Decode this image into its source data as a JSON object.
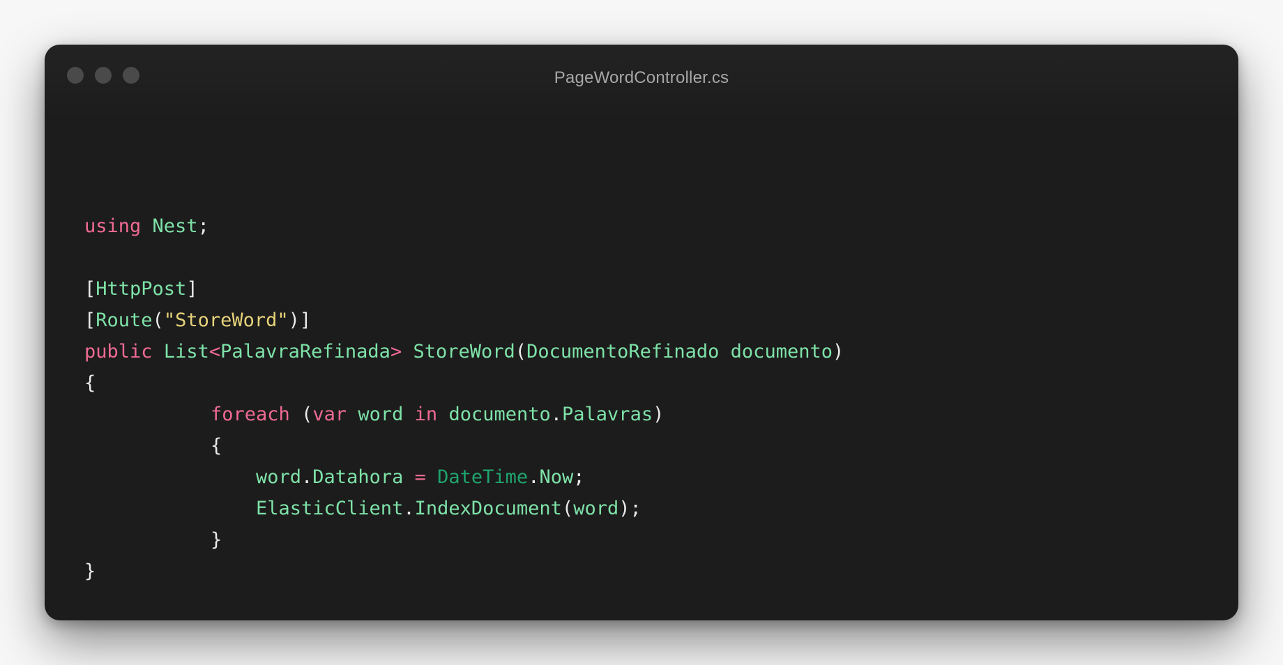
{
  "window": {
    "title": "PageWordController.cs"
  },
  "code": {
    "line1": {
      "using": "using",
      "ns": "Nest",
      "semi": ";"
    },
    "line3": {
      "open": "[",
      "attr": "HttpPost",
      "close": "]"
    },
    "line4": {
      "open": "[",
      "attr": "Route",
      "paren_open": "(",
      "arg": "\"StoreWord\"",
      "close": ")]"
    },
    "line5": {
      "public": "public",
      "list": "List",
      "lt": "<",
      "generic": "PalavraRefinada",
      "gt": ">",
      "method": "StoreWord",
      "paren_open": "(",
      "param_type": "DocumentoRefinado",
      "param_name": "documento",
      "paren_close": ")"
    },
    "line6": "{",
    "line7": {
      "foreach": "foreach",
      "paren_open": "(",
      "var": "var",
      "word": "word",
      "in": "in",
      "obj": "documento",
      "dot": ".",
      "prop": "Palavras",
      "paren_close": ")"
    },
    "line8": "{",
    "line9": {
      "obj": "word",
      "dot1": ".",
      "prop": "Datahora",
      "eq": "=",
      "cls": "DateTime",
      "dot2": ".",
      "now": "Now",
      "semi": ";"
    },
    "line10": {
      "client": "ElasticClient",
      "dot": ".",
      "method": "IndexDocument",
      "paren_open": "(",
      "arg": "word",
      "close": ");"
    },
    "line11": "}",
    "line12": "}"
  },
  "colors": {
    "window_bg": "#1c1c1c",
    "keyword": "#ef6b93",
    "type": "#7ee2a8",
    "datetime": "#1fa46e",
    "string": "#e8d37a",
    "punctuation": "#eaeaea",
    "title_text": "#a7a7a7",
    "window_dot": "#4a4a4a"
  }
}
